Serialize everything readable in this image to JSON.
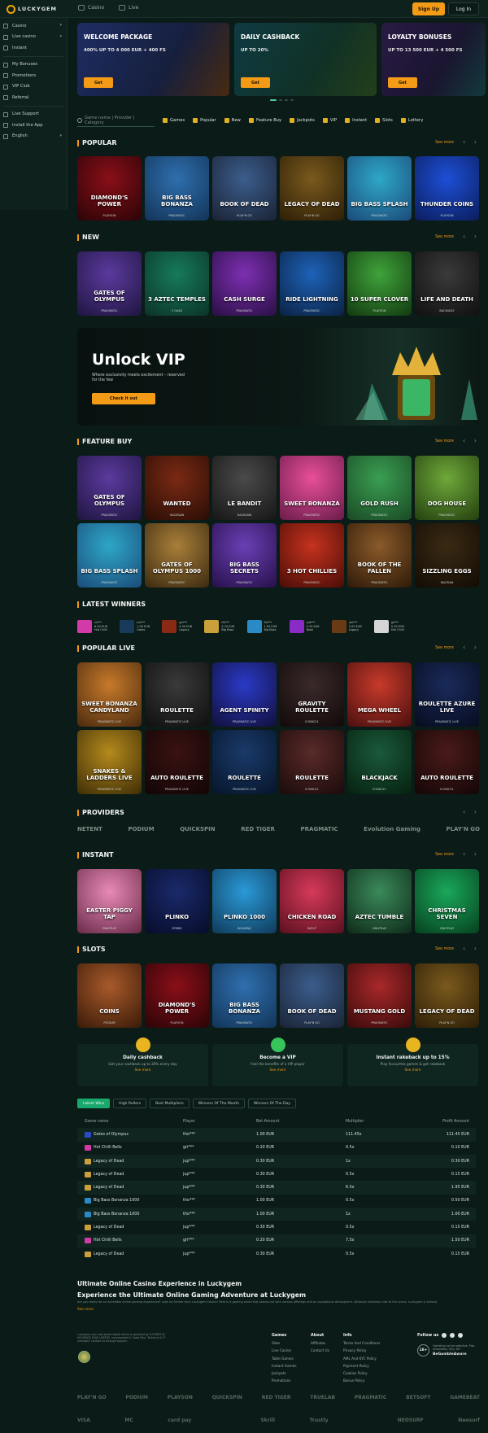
{
  "brand": {
    "name": "LUCKYGEM"
  },
  "topnav": {
    "casino": "Casino",
    "live": "Live",
    "signup": "Sign Up",
    "login": "Log In"
  },
  "sidebar": {
    "items": [
      {
        "label": "Casino",
        "chev": true
      },
      {
        "label": "Live casino",
        "chev": true
      },
      {
        "label": "Instant",
        "chev": false
      }
    ],
    "items2": [
      {
        "label": "My Bonuses"
      },
      {
        "label": "Promotions"
      },
      {
        "label": "VIP Club"
      },
      {
        "label": "Referral"
      }
    ],
    "items3": [
      {
        "label": "Live Support"
      },
      {
        "label": "Install the App"
      },
      {
        "label": "English",
        "chev": true
      }
    ]
  },
  "banners": [
    {
      "title": "WELCOME PACKAGE",
      "sub": "400% UP TO 4 000 EUR + 400 FS",
      "btn": "Get",
      "bg": "#1b2a4a"
    },
    {
      "title": "DAILY CASHBACK",
      "sub": "UP TO 20%",
      "btn": "Get",
      "bg": "#10323a"
    },
    {
      "title": "LOYALTY BONUSES",
      "sub": "UP TO 13 500 EUR + 4 500 FS",
      "btn": "Get",
      "bg": "#261a3c"
    }
  ],
  "search": {
    "placeholder": "Game name | Provider | Category"
  },
  "categories": [
    "Games",
    "Popular",
    "New",
    "Feature Buy",
    "Jackpots",
    "VIP",
    "Instant",
    "Slots",
    "Lottery"
  ],
  "sections": {
    "popular": "POPULAR",
    "new": "NEW",
    "feature_buy": "FEATURE BUY",
    "latest_winners": "LATEST WINNERS",
    "popular_live": "POPULAR LIVE",
    "providers": "PROVIDERS",
    "instant": "INSTANT",
    "slots": "SLOTS",
    "see_more": "See more"
  },
  "popular": [
    {
      "name": "DIAMOND'S POWER",
      "provider": "PLAYSON",
      "c1": "#8a0f18",
      "c2": "#2a0407"
    },
    {
      "name": "BIG BASS BONANZA",
      "provider": "PRAGMATIC",
      "c1": "#2f6fae",
      "c2": "#123458"
    },
    {
      "name": "BOOK OF DEAD",
      "provider": "PLAY'N GO",
      "c1": "#3b5d8c",
      "c2": "#1a2335"
    },
    {
      "name": "LEGACY OF DEAD",
      "provider": "PLAY'N GO",
      "c1": "#7a5a1d",
      "c2": "#2d1e07"
    },
    {
      "name": "BIG BASS SPLASH",
      "provider": "PRAGMATIC",
      "c1": "#2ea7c7",
      "c2": "#1b4b7a"
    },
    {
      "name": "THUNDER COINS",
      "provider": "PLAYSON",
      "c1": "#1d4fd6",
      "c2": "#0b1d5c"
    }
  ],
  "new": [
    {
      "name": "GATES OF OLYMPUS",
      "provider": "PRAGMATIC",
      "c1": "#5b3a9e",
      "c2": "#1f1540"
    },
    {
      "name": "3 AZTEC TEMPLES",
      "provider": "3 OAKS",
      "c1": "#167a5a",
      "c2": "#0b3328"
    },
    {
      "name": "CASH SURGE",
      "provider": "PRAGMATIC",
      "c1": "#7d2fb1",
      "c2": "#2a0f45"
    },
    {
      "name": "RIDE LIGHTNING",
      "provider": "PRAGMATIC",
      "c1": "#1d62b8",
      "c2": "#0b2244"
    },
    {
      "name": "10 SUPER CLOVER",
      "provider": "PLAYSON",
      "c1": "#3fa33a",
      "c2": "#123a10"
    },
    {
      "name": "LIFE AND DEATH",
      "provider": "BACKSEAT",
      "c1": "#3a3a3a",
      "c2": "#101010"
    }
  ],
  "vip": {
    "title": "Unlock VIP",
    "text": "Where exclusivity meets excitement – reserved for the few",
    "button": "Check it out"
  },
  "feature_buy": [
    {
      "name": "GATES OF OLYMPUS",
      "provider": "PRAGMATIC",
      "c1": "#5b3a9e",
      "c2": "#1f1540"
    },
    {
      "name": "WANTED",
      "provider": "HACKSAW",
      "c1": "#7a2a14",
      "c2": "#2a0d05"
    },
    {
      "name": "LE BANDIT",
      "provider": "HACKSAW",
      "c1": "#4a4a4a",
      "c2": "#161616"
    },
    {
      "name": "SWEET BONANZA",
      "provider": "PRAGMATIC",
      "c1": "#e84f9a",
      "c2": "#6a1b4a"
    },
    {
      "name": "GOLD RUSH",
      "provider": "PRAGMATIC",
      "c1": "#3a9e52",
      "c2": "#1a4a24"
    },
    {
      "name": "DOG HOUSE",
      "provider": "PRAGMATIC",
      "c1": "#6fa83a",
      "c2": "#23400f"
    },
    {
      "name": "BIG BASS SPLASH",
      "provider": "PRAGMATIC",
      "c1": "#2ea7c7",
      "c2": "#1b4b7a"
    },
    {
      "name": "GATES OF OLYMPUS 1000",
      "provider": "PRAGMATIC",
      "c1": "#a97f3a",
      "c2": "#3b2a10"
    },
    {
      "name": "BIG BASS SECRETS",
      "provider": "PRAGMATIC",
      "c1": "#6b3fb5",
      "c2": "#26104a"
    },
    {
      "name": "3 HOT CHILLIES",
      "provider": "PRAGMATIC",
      "c1": "#c6321f",
      "c2": "#4a0d06"
    },
    {
      "name": "BOOK OF THE FALLEN",
      "provider": "PRAGMATIC",
      "c1": "#8a5a2a",
      "c2": "#2e1a08"
    },
    {
      "name": "SIZZLING EGGS",
      "provider": "WAZDAN",
      "c1": "#3a2a14",
      "c2": "#120c04"
    }
  ],
  "latest_winners": [
    {
      "text": "rd***\n6.50 EUR\nHot Chilli",
      "c": "#d23aa8"
    },
    {
      "text": "tm***\n1.00 EUR\nGates",
      "c": "#173a5a"
    },
    {
      "text": "gh***\n0.30 EUR\nLegacy",
      "c": "#8a2a14"
    },
    {
      "text": "fhi***\n4.70 EUR\nBig Bass",
      "c": "#c9a03a"
    },
    {
      "text": "fhi***\n1.50 EUR\nBig Bass",
      "c": "#2a8ac7"
    },
    {
      "text": "jud***\n0.30 EUR\nBook",
      "c": "#8a2ac7"
    },
    {
      "text": "nhi***\n2.00 EUR\nLegacy",
      "c": "#6a3a14"
    },
    {
      "text": "gt***\n0.30 EUR\nHot Chilli",
      "c": "#d5d5d5"
    }
  ],
  "popular_live": [
    {
      "name": "SWEET BONANZA CANDYLAND",
      "provider": "PRAGMATIC LIVE",
      "c1": "#c77a2a",
      "c2": "#4a2a0f"
    },
    {
      "name": "ROULETTE",
      "provider": "PRAGMATIC LIVE",
      "c1": "#3a3a3a",
      "c2": "#0f0f0f"
    },
    {
      "name": "AGENT SPINITY",
      "provider": "PRAGMATIC LIVE",
      "c1": "#2a3ac7",
      "c2": "#120f3a"
    },
    {
      "name": "GRAVITY ROULETTE",
      "provider": "ICONIC21",
      "c1": "#3a2a2a",
      "c2": "#120909"
    },
    {
      "name": "MEGA WHEEL",
      "provider": "PRAGMATIC LIVE",
      "c1": "#c73a2a",
      "c2": "#4a0f0f"
    },
    {
      "name": "ROULETTE AZURE LIVE",
      "provider": "PRAGMATIC LIVE",
      "c1": "#1a2a5a",
      "c2": "#070c1f"
    },
    {
      "name": "SNAKES & LADDERS LIVE",
      "provider": "PRAGMATIC LIVE",
      "c1": "#b58a1d",
      "c2": "#3e2d06"
    },
    {
      "name": "AUTO ROULETTE",
      "provider": "PRAGMATIC LIVE",
      "c1": "#3a1212",
      "c2": "#120505"
    },
    {
      "name": "ROULETTE",
      "provider": "PRAGMATIC LIVE",
      "c1": "#1a3a6a",
      "c2": "#06152a"
    },
    {
      "name": "ROULETTE",
      "provider": "ICONIC21",
      "c1": "#5a2a2a",
      "c2": "#1a0a0a"
    },
    {
      "name": "BLACKJACK",
      "provider": "ICONIC21",
      "c1": "#1a5a3a",
      "c2": "#06200f"
    },
    {
      "name": "AUTO ROULETTE",
      "provider": "ICONIC21",
      "c1": "#4a1a1a",
      "c2": "#140606"
    }
  ],
  "providers": [
    "NETENT",
    "PODIUM",
    "QUICKSPIN",
    "RED TIGER",
    "PRAGMATIC",
    "Evolution Gaming",
    "PLAY'N GO"
  ],
  "instant": [
    {
      "name": "EASTER PIGGY TAP",
      "provider": "ONLYPLAY",
      "c1": "#e88ab5",
      "c2": "#6a2a4a"
    },
    {
      "name": "PLINKO",
      "provider": "SPRIBE",
      "c1": "#1a2a6a",
      "c2": "#070c2a"
    },
    {
      "name": "PLINKO 1000",
      "provider": "BGAMING",
      "c1": "#2a9ad7",
      "c2": "#0f3a5a"
    },
    {
      "name": "CHICKEN ROAD",
      "provider": "INOUT",
      "c1": "#d73a5a",
      "c2": "#5a0f1f"
    },
    {
      "name": "AZTEC TUMBLE",
      "provider": "ONLYPLAY",
      "c1": "#3a8a5a",
      "c2": "#0f2a1a"
    },
    {
      "name": "CHRISTMAS SEVEN",
      "provider": "ONLYPLAY",
      "c1": "#1aa85a",
      "c2": "#06401f"
    }
  ],
  "slots": [
    {
      "name": "COINS",
      "provider": "PODIUM",
      "c1": "#a85a2a",
      "c2": "#3a1a08"
    },
    {
      "name": "DIAMOND'S POWER",
      "provider": "PLAYSON",
      "c1": "#8a0f18",
      "c2": "#2a0407"
    },
    {
      "name": "BIG BASS BONANZA",
      "provider": "PRAGMATIC",
      "c1": "#2f6fae",
      "c2": "#123458"
    },
    {
      "name": "BOOK OF DEAD",
      "provider": "PLAY'N GO",
      "c1": "#3b5d8c",
      "c2": "#1a2335"
    },
    {
      "name": "MUSTANG GOLD",
      "provider": "PRAGMATIC",
      "c1": "#a8282a",
      "c2": "#3a0a0a"
    },
    {
      "name": "LEGACY OF DEAD",
      "provider": "PLAY'N GO",
      "c1": "#7a5a1d",
      "c2": "#2d1e07"
    }
  ],
  "features": [
    {
      "title": "Daily cashback",
      "sub": "Get your cashback up to 20% every day",
      "btn": "See more"
    },
    {
      "title": "Become a VIP",
      "sub": "Feel the benefits of a VIP player",
      "btn": "See more"
    },
    {
      "title": "Instant rakeback up to 15%",
      "sub": "Play favourites games & get rakeback",
      "btn": "See more"
    }
  ],
  "winner_tabs": [
    "Latest Wins",
    "High Rollers",
    "Best Multipliers",
    "Winners Of The Month",
    "Winners Of The Day"
  ],
  "table": {
    "headers": [
      "Game name",
      "Player",
      "Bet Amount",
      "Multiplier",
      "Profit Amount"
    ],
    "rows": [
      [
        "Gates of Olympus",
        "tho***",
        "1.00 EUR",
        "111.45x",
        "111.45 EUR",
        "#2a4ac7"
      ],
      [
        "Hot Chilli Bells",
        "gri***",
        "0.20 EUR",
        "0.5x",
        "0.10 EUR",
        "#d23aa8"
      ],
      [
        "Legacy of Dead",
        "jup***",
        "0.30 EUR",
        "1x",
        "0.30 EUR",
        "#c9a03a"
      ],
      [
        "Legacy of Dead",
        "jup***",
        "0.30 EUR",
        "0.5x",
        "0.15 EUR",
        "#c9a03a"
      ],
      [
        "Legacy of Dead",
        "jup***",
        "0.30 EUR",
        "6.5x",
        "1.95 EUR",
        "#c9a03a"
      ],
      [
        "Big Bass Bonanza 1000",
        "tho***",
        "1.00 EUR",
        "0.5x",
        "0.50 EUR",
        "#2a8ac7"
      ],
      [
        "Big Bass Bonanza 1000",
        "tho***",
        "1.00 EUR",
        "1x",
        "1.00 EUR",
        "#2a8ac7"
      ],
      [
        "Legacy of Dead",
        "jup***",
        "0.30 EUR",
        "0.5x",
        "0.15 EUR",
        "#c9a03a"
      ],
      [
        "Hot Chilli Bells",
        "gri***",
        "0.20 EUR",
        "7.5x",
        "1.50 EUR",
        "#d23aa8"
      ],
      [
        "Legacy of Dead",
        "jup***",
        "0.30 EUR",
        "0.5x",
        "0.15 EUR",
        "#c9a03a"
      ]
    ]
  },
  "seo": {
    "h1": "Ultimate Online Casino Experience in Luckygem",
    "h2": "Experience the Ultimate Online Gaming Adventure at Luckygem",
    "p": "Are you ready for an incredible online gaming experience? Look no further than Luckygem Casino! Here is a gaming world that stands out with various offerings and an exceptional atmosphere. Although relatively new to the scene, Luckygem is already",
    "more": "See more"
  },
  "footer": {
    "legal": "Luckygem.com web-based digital entity is operated by FUTURES IN HOLDINGS EVAS LIMITED, incorporated in Costa Rica. Technical & IT oversight. Contact us through support.",
    "games": {
      "title": "Games",
      "items": [
        "Slots",
        "Live Casino",
        "Table Games",
        "Instant Games",
        "Jackpots",
        "Promotions"
      ]
    },
    "about": {
      "title": "About",
      "items": [
        "Affiliates",
        "Contact Us"
      ]
    },
    "info": {
      "title": "Info",
      "items": [
        "Terms And Conditions",
        "Privacy Policy",
        "AML And KYC Policy",
        "Payment Policy",
        "Cookies Policy",
        "Bonus Policy"
      ]
    },
    "follow": "Follow us",
    "age": "18+",
    "age_text": "Gambling can be addictive. Play responsibly. Only 18+",
    "bga": "BeGambleAware"
  },
  "partner_logos": [
    "PLAY'N GO",
    "PODIUM",
    "PLAYSON",
    "QUICKSPIN",
    "RED TIGER",
    "TRUELAB",
    "PRAGMATIC",
    "BETSOFT",
    "GAMEBEAT"
  ],
  "pay_logos": [
    "VISA",
    "MC",
    "card pay",
    "",
    "Skrill",
    "Trustly",
    "",
    "NEOSURF",
    "Neosurf"
  ]
}
